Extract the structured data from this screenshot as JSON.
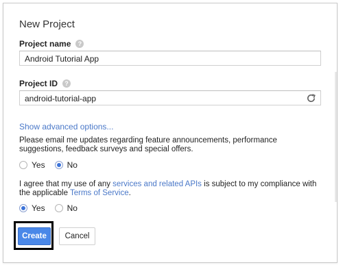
{
  "dialog": {
    "title": "New Project",
    "project_name": {
      "label": "Project name",
      "value": "Android Tutorial App",
      "help_icon": "question-icon"
    },
    "project_id": {
      "label": "Project ID",
      "value": "android-tutorial-app",
      "help_icon": "question-icon",
      "refresh_icon": "refresh-icon"
    },
    "advanced_link": "Show advanced options...",
    "email_updates": {
      "text": "Please email me updates regarding feature announcements, performance suggestions, feedback surveys and special offers.",
      "options": [
        {
          "label": "Yes",
          "selected": false
        },
        {
          "label": "No",
          "selected": true
        }
      ]
    },
    "terms": {
      "text_1": "I agree that my use of any ",
      "link_1": "services and related APIs",
      "text_2": " is subject to my compliance with the applicable ",
      "link_2": "Terms of Service",
      "text_3": ".",
      "options": [
        {
          "label": "Yes",
          "selected": true
        },
        {
          "label": "No",
          "selected": false
        }
      ]
    },
    "buttons": {
      "create": "Create",
      "cancel": "Cancel"
    }
  },
  "colors": {
    "accent": "#4a88e8",
    "link": "#4a78c8",
    "highlight_border": "#000000"
  }
}
